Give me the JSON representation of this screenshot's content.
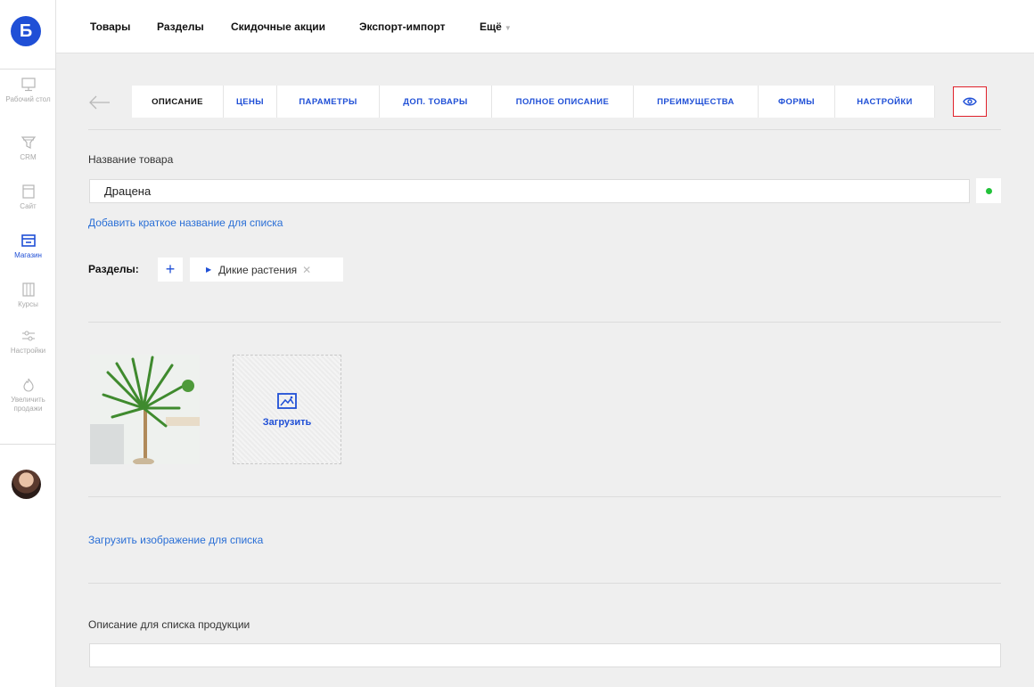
{
  "app": {
    "logo_letter": "Б"
  },
  "topnav": {
    "items": [
      "Товары",
      "Разделы",
      "Скидочные акции",
      "Экспорт-импорт",
      "Ещё"
    ]
  },
  "sidebar": {
    "items": [
      {
        "label": "Рабочий стол",
        "icon": "desktop-icon",
        "active": false
      },
      {
        "label": "CRM",
        "icon": "funnel-icon",
        "active": false
      },
      {
        "label": "Сайт",
        "icon": "site-icon",
        "active": false
      },
      {
        "label": "Магазин",
        "icon": "shop-icon",
        "active": true
      },
      {
        "label": "Курсы",
        "icon": "courses-icon",
        "active": false
      },
      {
        "label": "Настройки",
        "icon": "settings-sliders-icon",
        "active": false
      },
      {
        "label": "Увеличить продажи",
        "icon": "flame-icon",
        "active": false
      }
    ]
  },
  "tabs": [
    {
      "label": "ОПИСАНИЕ",
      "active": true
    },
    {
      "label": "ЦЕНЫ",
      "active": false
    },
    {
      "label": "ПАРАМЕТРЫ",
      "active": false
    },
    {
      "label": "ДОП. ТОВАРЫ",
      "active": false
    },
    {
      "label": "ПОЛНОЕ ОПИСАНИЕ",
      "active": false
    },
    {
      "label": "ПРЕИМУЩЕСТВА",
      "active": false
    },
    {
      "label": "ФОРМЫ",
      "active": false
    },
    {
      "label": "НАСТРОЙКИ",
      "active": false
    }
  ],
  "form": {
    "product_name_label": "Название товара",
    "product_name_value": "Драцена",
    "add_short_name_link": "Добавить краткое название для списка",
    "sections_label": "Разделы:",
    "section_chip": "Дикие растения",
    "upload_label": "Загрузить",
    "upload_list_image_link": "Загрузить изображение для списка",
    "list_description_label": "Описание для списка продукции",
    "list_description_value": ""
  },
  "colors": {
    "accent": "#1f4fd6",
    "status_green": "#22c23a",
    "highlight_red": "#e0202a"
  }
}
